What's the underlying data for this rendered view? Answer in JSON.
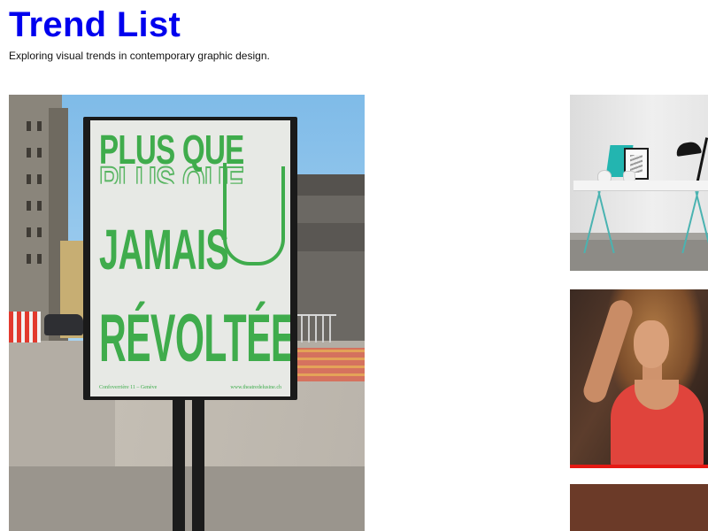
{
  "header": {
    "site_title": "Trend List",
    "tagline": "Exploring visual trends in contemporary graphic design."
  },
  "gallery": {
    "featured": {
      "icon": "poster-photo",
      "poster": {
        "line1": "PLUS QUE",
        "line2": "JAMAIS",
        "line3": "RÉVOLTÉES",
        "footer_left": "Confoverrière 11 – Genève",
        "footer_right": "www.theatredelusine.ch",
        "accent_color": "#3fac4c"
      }
    },
    "thumbnails": [
      {
        "icon": "desk-interior-photo"
      },
      {
        "icon": "portrait-red-swimsuit-photo"
      },
      {
        "icon": "brown-image"
      }
    ]
  },
  "colors": {
    "title": "#0000ee",
    "background": "#ffffff"
  }
}
